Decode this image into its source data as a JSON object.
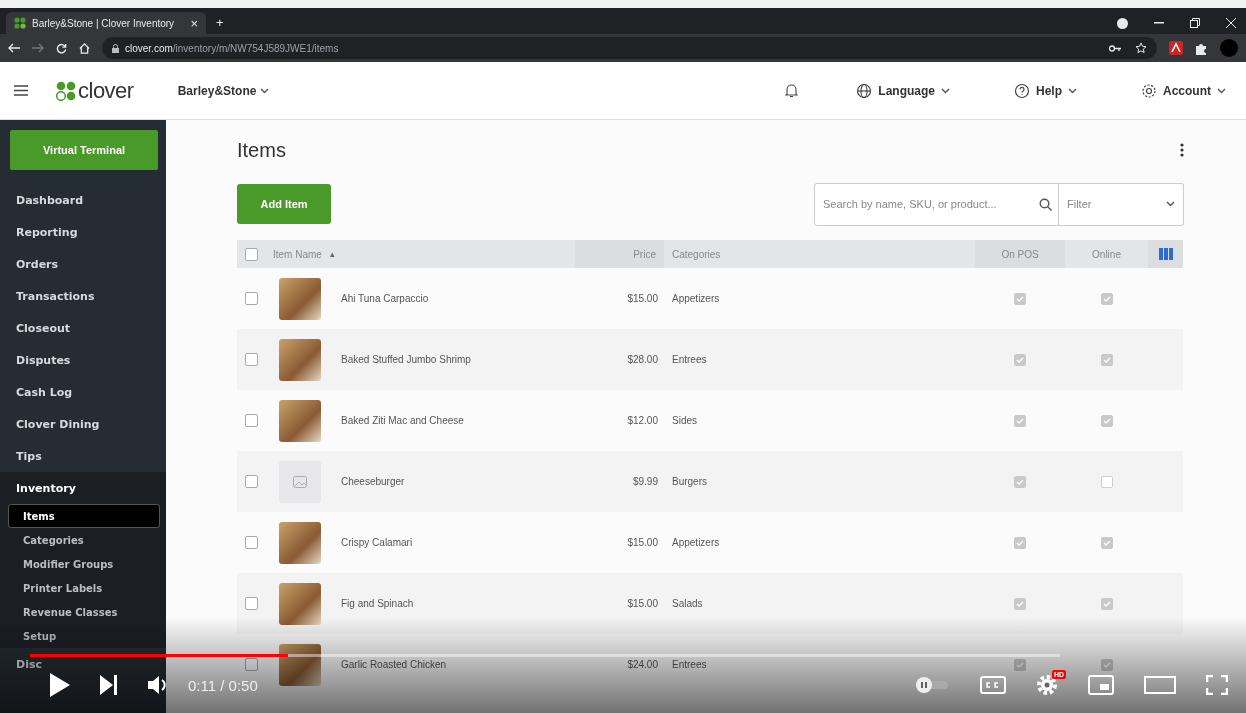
{
  "browser": {
    "tab_title": "Barley&Stone | Clover Inventory",
    "tab_close": "×",
    "new_tab": "+",
    "url_host": "clover.com",
    "url_path": "/inventory/m/NW754J589JWE1/items"
  },
  "header": {
    "logo": "clover",
    "merchant": "Barley&Stone",
    "menus": [
      {
        "label": "Language"
      },
      {
        "label": "Help"
      },
      {
        "label": "Account"
      }
    ]
  },
  "sidebar": {
    "primary_button": "Virtual Terminal",
    "items": [
      {
        "label": "Dashboard",
        "selected": false
      },
      {
        "label": "Reporting",
        "selected": false
      },
      {
        "label": "Orders",
        "selected": false
      },
      {
        "label": "Transactions",
        "selected": false
      },
      {
        "label": "Closeout",
        "selected": false
      },
      {
        "label": "Disputes",
        "selected": false
      },
      {
        "label": "Cash Log",
        "selected": false
      },
      {
        "label": "Clover Dining",
        "selected": false
      },
      {
        "label": "Tips",
        "selected": false
      },
      {
        "label": "Inventory",
        "selected": false,
        "expanded": true,
        "children": [
          {
            "label": "Items",
            "selected": true
          },
          {
            "label": "Categories",
            "selected": false
          },
          {
            "label": "Modifier Groups",
            "selected": false
          },
          {
            "label": "Printer Labels",
            "selected": false
          },
          {
            "label": "Revenue Classes",
            "selected": false
          },
          {
            "label": "Setup",
            "selected": false
          }
        ]
      },
      {
        "label": "Disc",
        "selected": false
      }
    ]
  },
  "page": {
    "title": "Items",
    "add_button": "Add Item",
    "search": {
      "placeholder": "Search by name, SKU, or product..."
    },
    "filter": {
      "placeholder": "Filter"
    }
  },
  "table": {
    "select_all": {
      "checked": false
    },
    "columns": [
      {
        "label": "Item Name",
        "sort_mark": "▴"
      },
      {
        "label": "Price"
      },
      {
        "label": "Categories"
      },
      {
        "label": "On POS"
      },
      {
        "label": "Online"
      }
    ],
    "rows": [
      {
        "name": "Ahi Tuna Carpaccio",
        "price": "$15.00",
        "category": "Appetizers",
        "on_pos": true,
        "online": true,
        "selected": false,
        "kind": "photo"
      },
      {
        "name": "Baked Stuffed Jumbo Shrimp",
        "price": "$28.00",
        "category": "Entrees",
        "on_pos": true,
        "online": true,
        "selected": false,
        "kind": "photo"
      },
      {
        "name": "Baked Ziti Mac and Cheese",
        "price": "$12.00",
        "category": "Sides",
        "on_pos": true,
        "online": true,
        "selected": false,
        "kind": "photo"
      },
      {
        "name": "Cheeseburger",
        "price": "$9.99",
        "category": "Burgers",
        "on_pos": true,
        "online": false,
        "selected": false,
        "kind": "placeholder"
      },
      {
        "name": "Crispy Calamari",
        "price": "$15.00",
        "category": "Appetizers",
        "on_pos": true,
        "online": true,
        "selected": false,
        "kind": "photo"
      },
      {
        "name": "Fig and Spinach",
        "price": "$15.00",
        "category": "Salads",
        "on_pos": true,
        "online": true,
        "selected": false,
        "kind": "photo"
      },
      {
        "name": "Garlic Roasted Chicken",
        "price": "$24.00",
        "category": "Entrees",
        "on_pos": true,
        "online": true,
        "selected": false,
        "kind": "photo"
      }
    ]
  },
  "video": {
    "time": "0:11 / 0:50",
    "level": 0.25,
    "hd_badge": "HD"
  }
}
